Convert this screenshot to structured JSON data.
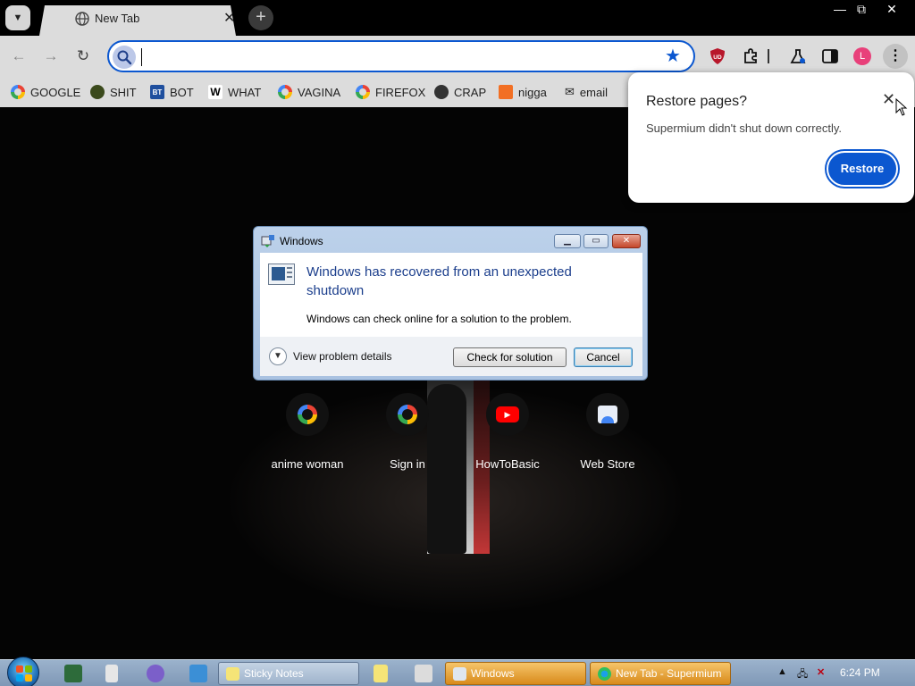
{
  "browser": {
    "tab_title": "New Tab",
    "omnibox": {
      "value": "",
      "placeholder": ""
    },
    "window_controls": {
      "minimize": "—",
      "maximize": "⧉",
      "close": "✕"
    }
  },
  "bookmarks": [
    {
      "label": "GOOGLE",
      "icon": "google-icon"
    },
    {
      "label": "SHIT",
      "icon": "site-icon"
    },
    {
      "label": "BOT",
      "icon": "bt-icon",
      "badge": "BT"
    },
    {
      "label": "WHAT",
      "icon": "wikipedia-icon",
      "badge": "W"
    },
    {
      "label": "VAGINA",
      "icon": "google-icon"
    },
    {
      "label": "FIREFOX",
      "icon": "google-icon"
    },
    {
      "label": "CRAP",
      "icon": "site-icon"
    },
    {
      "label": "nigga",
      "icon": "soundcloud-icon"
    },
    {
      "label": "email",
      "icon": "mail-icon"
    }
  ],
  "extensions": {
    "ublock_badge": "UD",
    "profile_initial": "L"
  },
  "restore_popup": {
    "title": "Restore pages?",
    "message": "Supermium didn't shut down correctly.",
    "button": "Restore"
  },
  "dialog": {
    "title": "Windows",
    "heading": "Windows has recovered from an unexpected shutdown",
    "message": "Windows can check online for a solution to the problem.",
    "details_label": "View problem details",
    "check_button": "Check for solution",
    "cancel_button": "Cancel"
  },
  "shortcuts": [
    {
      "label": "anime woman",
      "icon": "google-icon"
    },
    {
      "label": "Sign in",
      "icon": "google-icon"
    },
    {
      "label": "HowToBasic",
      "icon": "youtube-icon"
    },
    {
      "label": "Web Store",
      "icon": "webstore-icon"
    }
  ],
  "taskbar": {
    "tasks": [
      {
        "label": "Sticky Notes",
        "active": false
      },
      {
        "label": "Windows",
        "active": true
      },
      {
        "label": "New Tab - Supermium",
        "active": true
      }
    ],
    "clock": "6:24 PM"
  },
  "colors": {
    "accent": "#0b57d0",
    "chrome": "#dcdcdc",
    "dialog_heading": "#1b3e8c",
    "taskbar_active": "#d88a1b"
  }
}
